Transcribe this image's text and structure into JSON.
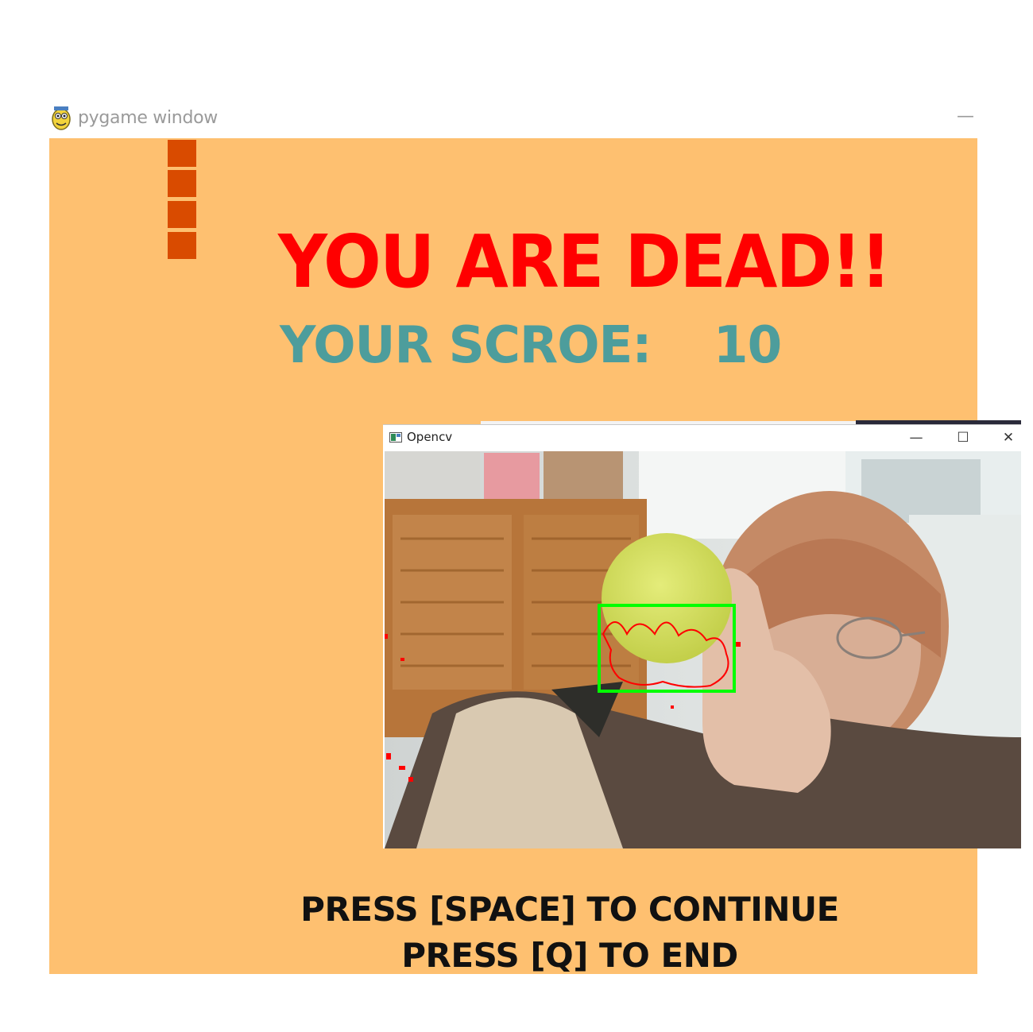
{
  "pygame_window": {
    "title": "pygame window",
    "minimize_glyph": "—",
    "icon": "pygame-snake-icon"
  },
  "game": {
    "background_color": "#fec070",
    "snake_color": "#d94b00",
    "snake_segments": 4,
    "dead_message": "YOU ARE DEAD!!",
    "score_label": "YOUR SCROE:",
    "score_value": "10",
    "continue_prompt": "PRESS [SPACE] TO CONTINUE",
    "end_prompt": "PRESS [Q] TO END"
  },
  "opencv_window": {
    "title": "Opencv",
    "minimize_glyph": "—",
    "maximize_glyph": "☐",
    "close_glyph": "✕",
    "icon": "opencv-window-icon",
    "detection_box_color": "#00ff00",
    "contour_color": "#ff0000"
  }
}
